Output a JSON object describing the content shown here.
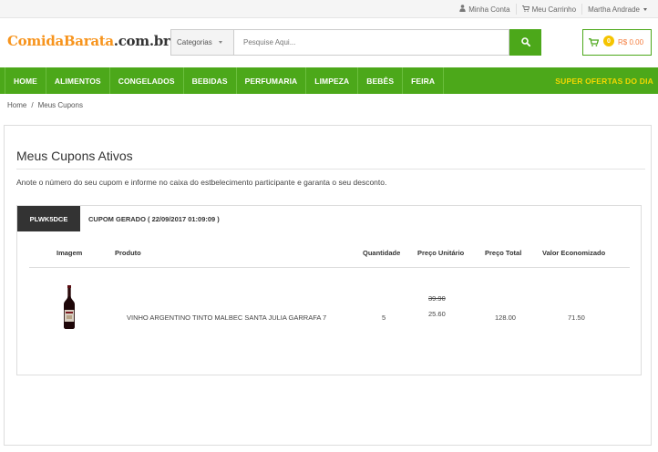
{
  "topbar": {
    "account": "Minha Conta",
    "cart": "Meu Carrinho",
    "user": "Martha Andrade"
  },
  "header": {
    "logo_part1": "ComidaBarata",
    "logo_part2": ".com.br",
    "category_select": "Categorias",
    "search_placeholder": "Pesquise Aqui...",
    "cart_count": "0",
    "cart_total": "R$ 0.00"
  },
  "nav": {
    "items": [
      "HOME",
      "ALIMENTOS",
      "CONGELADOS",
      "BEBIDAS",
      "PERFUMARIA",
      "LIMPEZA",
      "BEBÊS",
      "FEIRA"
    ],
    "offer": "SUPER OFERTAS DO DIA"
  },
  "breadcrumb": {
    "home": "Home",
    "separator": "/",
    "current": "Meus Cupons"
  },
  "main": {
    "title": "Meus Cupons Ativos",
    "instructions": "Anote o número do seu cupom e informe no caixa do estbelecimento participante e garanta o seu desconto."
  },
  "coupon": {
    "code": "PLWK5DCE",
    "generated": "CUPOM GERADO ( 22/09/2017 01:09:09 )",
    "columns": [
      "Imagem",
      "Produto",
      "Quantidade",
      "Preço Unitário",
      "Preço Total",
      "Valor Economizado"
    ],
    "rows": [
      {
        "product": "VINHO ARGENTINO TINTO MALBEC SANTA JULIA GARRAFA 7",
        "quantity": "5",
        "old_price": "39.90",
        "unit_price": "25.60",
        "total": "128.00",
        "saved": "71.50"
      }
    ]
  },
  "colors": {
    "brand_green": "#4ca81a",
    "logo_orange": "#f7941d",
    "offer_yellow": "#f5d800",
    "badge_yellow": "#f5c400",
    "price_orange": "#f47c3c"
  },
  "icons": [
    "user-icon",
    "cart-icon",
    "search-icon",
    "wine-bottle-image"
  ]
}
